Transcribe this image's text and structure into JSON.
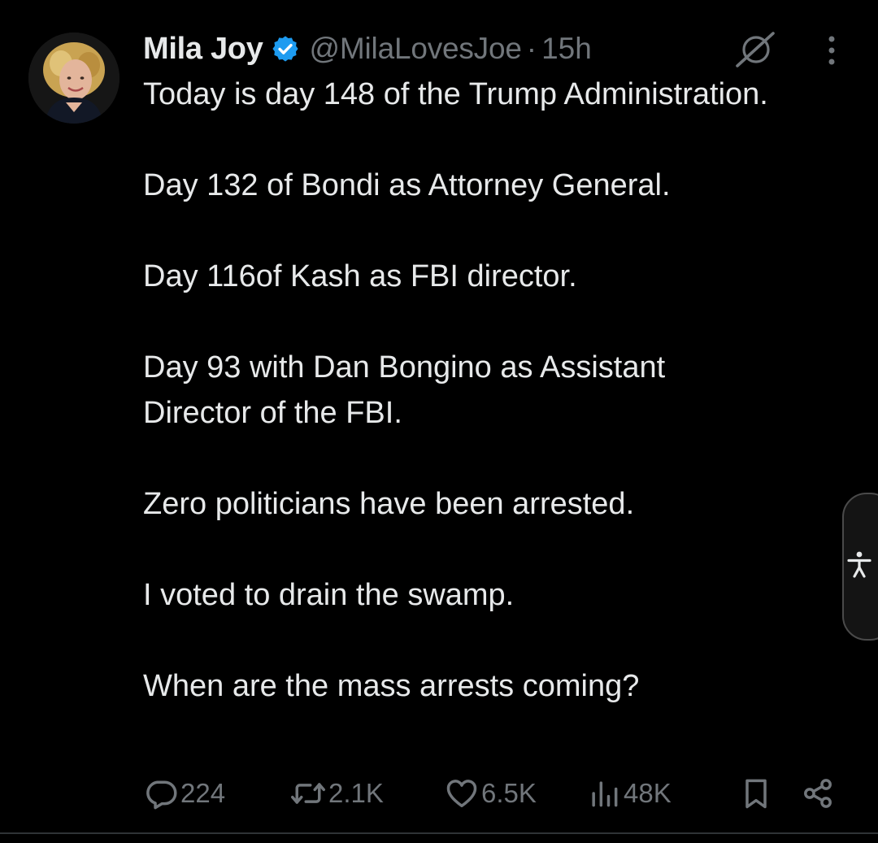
{
  "tweet": {
    "author": {
      "name": "Mila Joy",
      "handle": "@MilaLovesJoe",
      "separator": "·",
      "time": "15h",
      "verified": true
    },
    "body": [
      "Today is day 148 of the Trump Administration.",
      "Day 132 of Bondi as Attorney General.",
      "Day 116of Kash as FBI director.",
      "Day 93 with Dan Bongino as Assistant Director of the FBI.",
      "Zero politicians have been arrested.",
      "I voted to drain the swamp.",
      "When are the mass arrests coming?"
    ],
    "actions": {
      "replies": "224",
      "reposts": "2.1K",
      "likes": "6.5K",
      "views": "48K"
    }
  },
  "icons": {
    "avatar": "avatar",
    "verified": "verified-badge-icon",
    "grok": "grok-icon",
    "more": "more-vertical-icon",
    "reply": "reply-icon",
    "repost": "repost-icon",
    "like": "heart-icon",
    "views": "views-icon",
    "bookmark": "bookmark-icon",
    "share": "share-icon",
    "accessibility": "accessibility-icon"
  },
  "colors": {
    "background": "#000000",
    "text": "#e7e9ea",
    "muted": "#71767b",
    "verified": "#1d9bf0"
  }
}
